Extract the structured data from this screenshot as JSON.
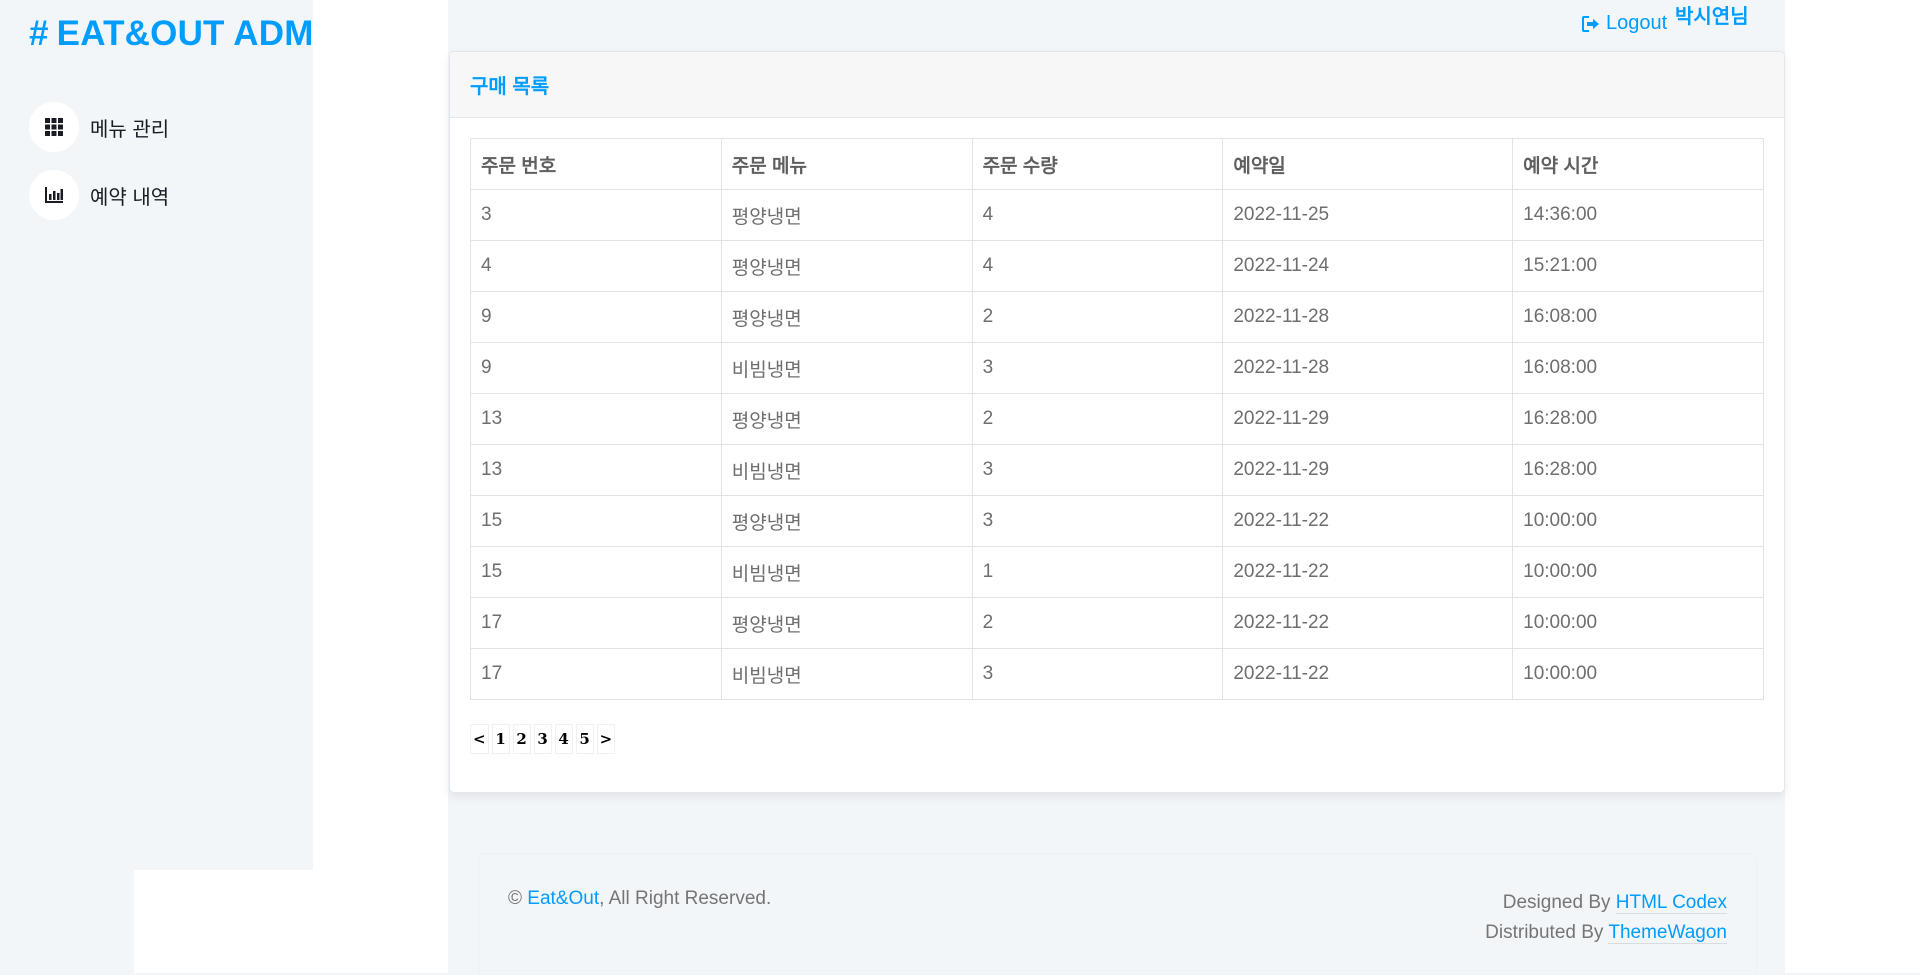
{
  "brand": {
    "hash": "#",
    "title": "EAT&OUT ADM"
  },
  "sidebar": {
    "items": [
      {
        "label": "메뉴 관리",
        "icon": "grid-icon"
      },
      {
        "label": "예약 내역",
        "icon": "chart-bar-icon"
      }
    ]
  },
  "topbar": {
    "logout_label": "Logout",
    "user_name": "박시연님"
  },
  "card": {
    "title": "구매 목록",
    "columns": [
      "주문 번호",
      "주문 메뉴",
      "주문 수량",
      "예약일",
      "예약 시간"
    ],
    "rows": [
      [
        "3",
        "평양냉면",
        "4",
        "2022-11-25",
        "14:36:00"
      ],
      [
        "4",
        "평양냉면",
        "4",
        "2022-11-24",
        "15:21:00"
      ],
      [
        "9",
        "평양냉면",
        "2",
        "2022-11-28",
        "16:08:00"
      ],
      [
        "9",
        "비빔냉면",
        "3",
        "2022-11-28",
        "16:08:00"
      ],
      [
        "13",
        "평양냉면",
        "2",
        "2022-11-29",
        "16:28:00"
      ],
      [
        "13",
        "비빔냉면",
        "3",
        "2022-11-29",
        "16:28:00"
      ],
      [
        "15",
        "평양냉면",
        "3",
        "2022-11-22",
        "10:00:00"
      ],
      [
        "15",
        "비빔냉면",
        "1",
        "2022-11-22",
        "10:00:00"
      ],
      [
        "17",
        "평양냉면",
        "2",
        "2022-11-22",
        "10:00:00"
      ],
      [
        "17",
        "비빔냉면",
        "3",
        "2022-11-22",
        "10:00:00"
      ]
    ]
  },
  "pagination": {
    "prev": "<",
    "pages": [
      "1",
      "2",
      "3",
      "4",
      "5"
    ],
    "next": ">"
  },
  "footer": {
    "copyright_symbol": "©",
    "site_link": "Eat&Out",
    "rights_text": ", All Right Reserved.",
    "designed_by_label": "Designed By",
    "designed_by_link": "HTML Codex",
    "distributed_by_label": "Distributed By",
    "distributed_by_link": "ThemeWagon"
  },
  "colors": {
    "accent": "#009cff",
    "background": "#f3f6f9",
    "text": "#757575"
  }
}
